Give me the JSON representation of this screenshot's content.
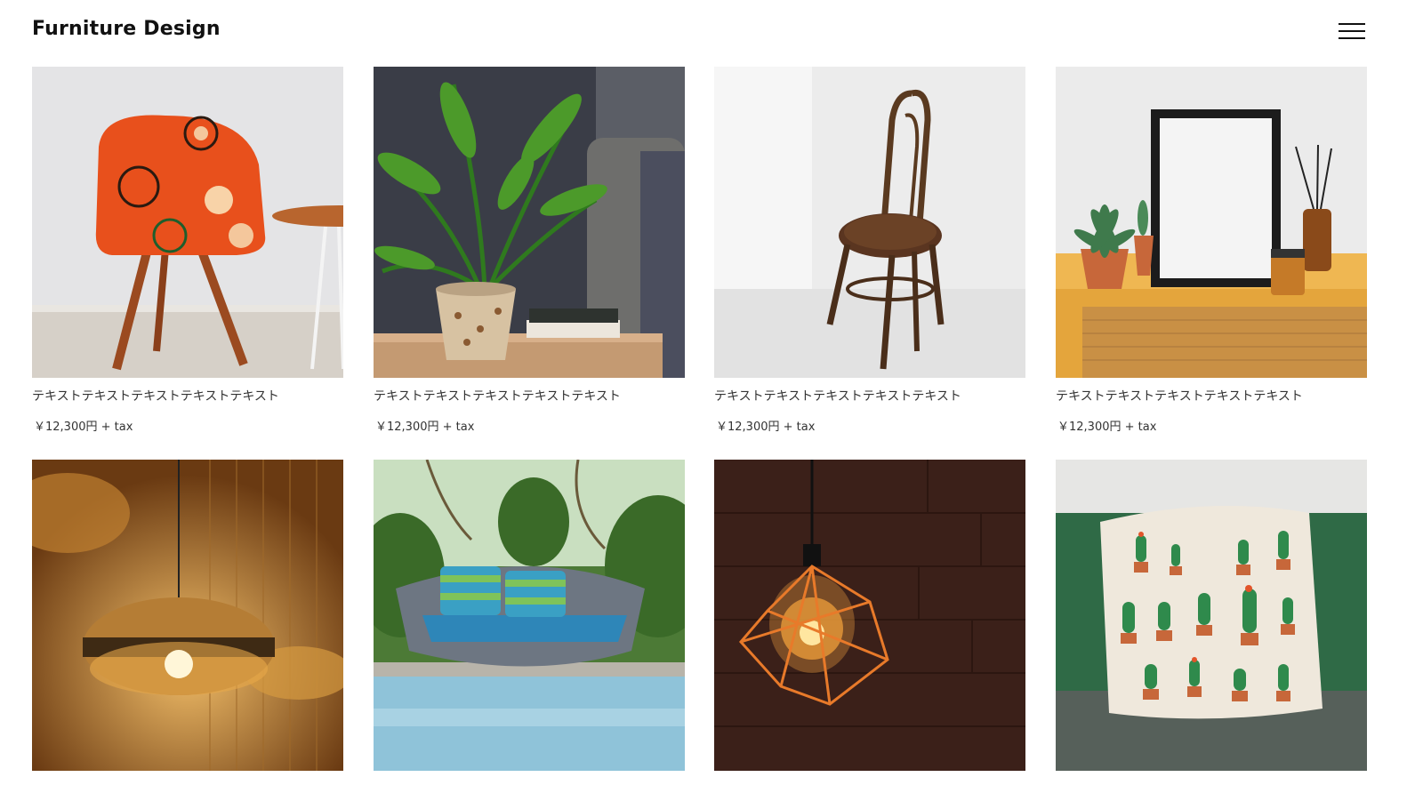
{
  "header": {
    "title": "Furniture Design"
  },
  "products": [
    {
      "name": "テキストテキストテキストテキストテキスト",
      "price": "￥12,300円 + tax",
      "image": "orange-patterned-chair"
    },
    {
      "name": "テキストテキストテキストテキストテキスト",
      "price": "￥12,300円 + tax",
      "image": "potted-palm-plant"
    },
    {
      "name": "テキストテキストテキストテキストテキスト",
      "price": "￥12,300円 + tax",
      "image": "bentwood-chair"
    },
    {
      "name": "テキストテキストテキストテキストテキスト",
      "price": "￥12,300円 + tax",
      "image": "frame-and-succulents"
    },
    {
      "name": "",
      "price": "",
      "image": "rattan-pendant-lamp"
    },
    {
      "name": "",
      "price": "",
      "image": "outdoor-daybed-pool"
    },
    {
      "name": "",
      "price": "",
      "image": "geometric-edison-lamp"
    },
    {
      "name": "",
      "price": "",
      "image": "cactus-print-pillow"
    }
  ]
}
